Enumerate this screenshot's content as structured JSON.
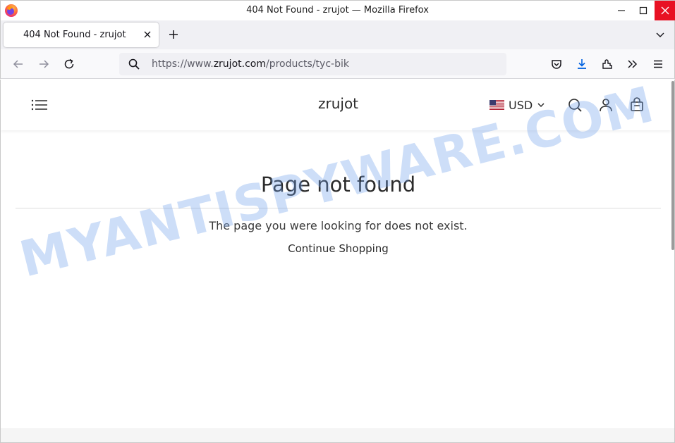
{
  "window": {
    "title": "404 Not Found - zrujot — Mozilla Firefox"
  },
  "tabs": [
    {
      "label": "404 Not Found - zrujot",
      "active": true
    }
  ],
  "navbar": {
    "url_prefix": "https://www.",
    "url_host": "zrujot.com",
    "url_path": "/products/tyc-bik"
  },
  "site": {
    "brand": "zrujot",
    "currency": "USD"
  },
  "content": {
    "heading": "Page not found",
    "message": "The page you were looking for does not exist.",
    "continue_label": "Continue Shopping"
  },
  "watermark": {
    "text": "MYANTISPYWARE.COM"
  },
  "colors": {
    "close_button": "#e81123",
    "download_icon": "#0061e0",
    "watermark": "#70a0eb"
  },
  "icons": [
    "firefox-logo-icon",
    "minimize-icon",
    "maximize-icon",
    "close-icon",
    "tab-close-icon",
    "plus-icon",
    "chevron-down-icon",
    "back-arrow-icon",
    "forward-arrow-icon",
    "reload-icon",
    "search-icon",
    "pocket-icon",
    "download-icon",
    "extensions-icon",
    "overflow-icon",
    "menu-icon",
    "hamburger-icon",
    "us-flag-icon",
    "account-icon",
    "cart-icon"
  ]
}
